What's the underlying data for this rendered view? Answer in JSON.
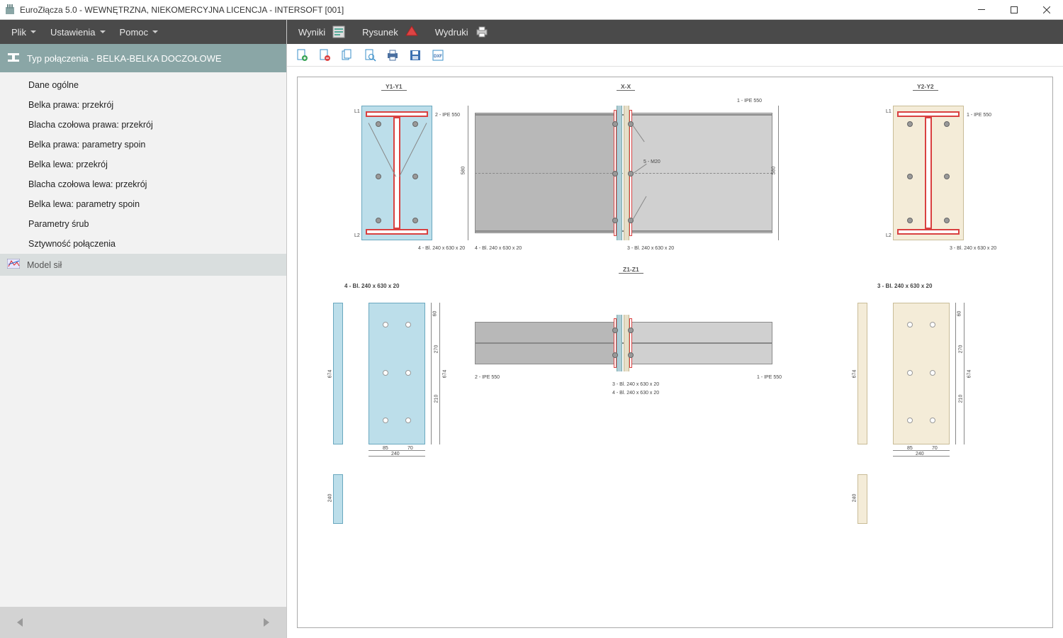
{
  "window": {
    "title": "EuroZłącza 5.0 - WEWNĘTRZNA, NIEKOMERCYJNA LICENCJA - INTERSOFT [001]"
  },
  "menu_left": {
    "items": [
      "Plik",
      "Ustawienia",
      "Pomoc"
    ]
  },
  "menu_right": {
    "items": [
      "Wyniki",
      "Rysunek",
      "Wydruki"
    ]
  },
  "doc_toolbar": {
    "icons": [
      "new",
      "page",
      "page-copy",
      "zoom",
      "print",
      "save",
      "dxf"
    ]
  },
  "nav": {
    "header": "Typ połączenia - BELKA-BELKA DOCZOŁOWE",
    "items": [
      "Dane ogólne",
      "Belka prawa: przekrój",
      "Blacha czołowa prawa: przekrój",
      "Belka prawa: parametry spoin",
      "Belka lewa: przekrój",
      "Blacha czołowa lewa: przekrój",
      "Belka lewa: parametry spoin",
      "Parametry śrub",
      "Sztywność połączenia"
    ],
    "footer_item": "Model sił"
  },
  "drawing": {
    "sections": {
      "y1": "Y1-Y1",
      "xx": "X-X",
      "y2": "Y2-Y2",
      "z1": "Z1-Z1"
    },
    "labels": {
      "ipe_left": "2 - IPE 550",
      "ipe_right": "1 - IPE 550",
      "bolt_spec": "5 - M20",
      "plate4": "4 - Bl. 240 x 630 x 20",
      "plate3": "3 - Bl. 240 x 630 x 20",
      "l1": "L1",
      "l2": "L2"
    },
    "dims": {
      "w_240": "240",
      "w_85": "85",
      "w_70": "70",
      "h_580": "580",
      "h_60": "60",
      "h_270": "270",
      "h_210": "210",
      "h_674": "674"
    }
  },
  "colors": {
    "plate_left": "#bcdeea",
    "plate_right": "#f4ecd8",
    "flange": "#d94040",
    "beam": "#b8b8b8"
  }
}
